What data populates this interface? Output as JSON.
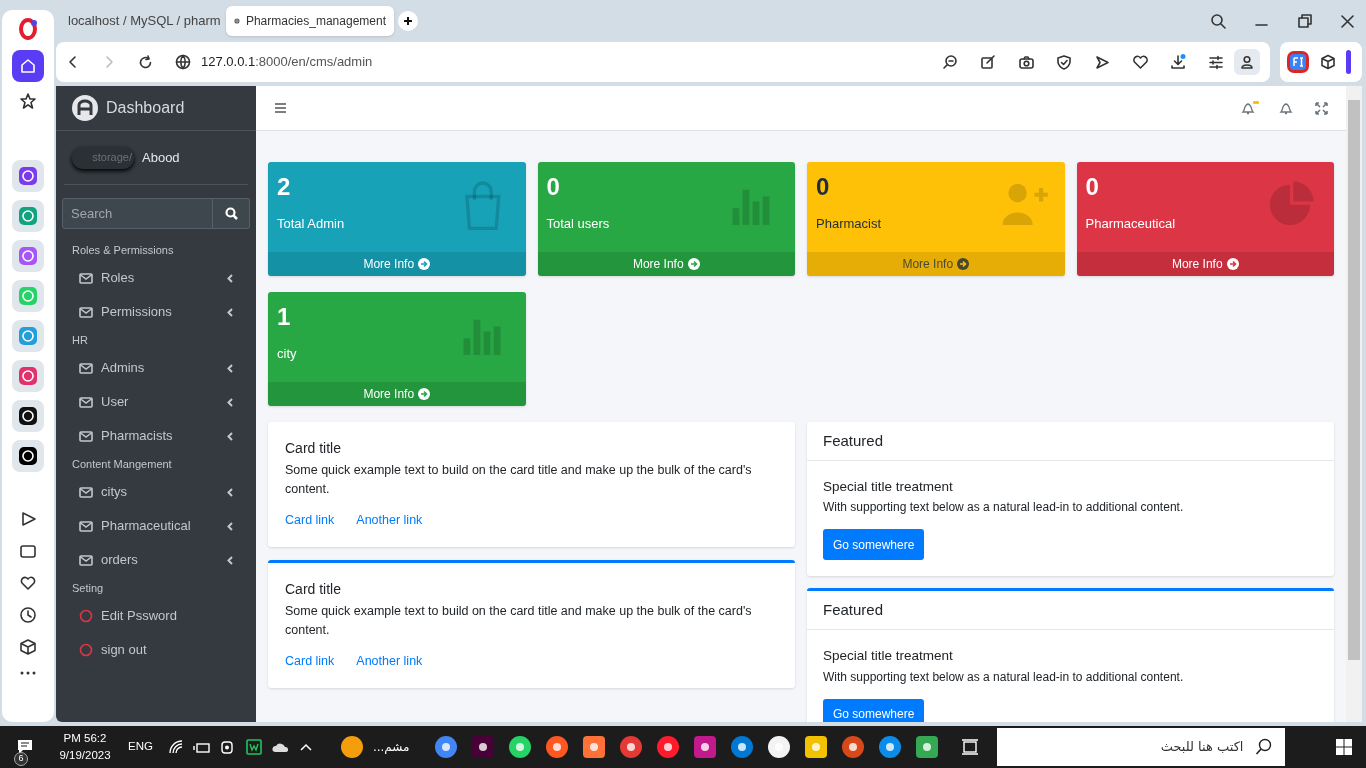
{
  "browser": {
    "tabs": [
      {
        "title": "localhost / MySQL / pharm",
        "selected": false
      },
      {
        "title": "Pharmacies_management",
        "selected": true
      }
    ],
    "url_host": "127.0.0.1",
    "url_rest": ":8000/en/cms/admin"
  },
  "sidebar": {
    "brand": "Dashboard",
    "user_image_alt": "storage/",
    "user": "Abood",
    "search_placeholder": "Search",
    "sections": [
      {
        "title": "Roles & Permissions",
        "items": [
          {
            "label": "Roles",
            "kind": "menu"
          },
          {
            "label": "Permissions",
            "kind": "menu"
          }
        ]
      },
      {
        "title": "HR",
        "items": [
          {
            "label": "Admins",
            "kind": "menu"
          },
          {
            "label": "User",
            "kind": "menu"
          },
          {
            "label": "Pharmacists",
            "kind": "menu"
          }
        ]
      },
      {
        "title": "Content Mangement",
        "items": [
          {
            "label": "citys",
            "kind": "menu"
          },
          {
            "label": "Pharmaceutical",
            "kind": "menu"
          },
          {
            "label": "orders",
            "kind": "menu"
          }
        ]
      },
      {
        "title": "Seting",
        "items": [
          {
            "label": "Edit Pssword",
            "kind": "action"
          },
          {
            "label": "sign out",
            "kind": "action"
          }
        ]
      }
    ]
  },
  "stats": [
    {
      "value": "2",
      "label": "Total Admin",
      "link": "More Info",
      "color": "#17a2b8",
      "dark_text": false,
      "kind": "bag"
    },
    {
      "value": "0",
      "label": "Total users",
      "link": "More Info",
      "color": "#28a745",
      "dark_text": false,
      "kind": "chart"
    },
    {
      "value": "0",
      "label": "Pharmacist",
      "link": "More Info",
      "color": "#ffc107",
      "dark_text": true,
      "kind": "person"
    },
    {
      "value": "0",
      "label": "Pharmaceutical",
      "link": "More Info",
      "color": "#dc3545",
      "dark_text": false,
      "kind": "pie"
    },
    {
      "value": "1",
      "label": "city",
      "link": "More Info",
      "color": "#28a745",
      "dark_text": false,
      "kind": "chart"
    }
  ],
  "cards": [
    {
      "title": "Card title",
      "text": "Some quick example text to build on the card title and make up the bulk of the card's content.",
      "links": [
        "Card link",
        "Another link"
      ],
      "outline": false
    },
    {
      "title": "Card title",
      "text": "Some quick example text to build on the card title and make up the bulk of the card's content.",
      "links": [
        "Card link",
        "Another link"
      ],
      "outline": true
    }
  ],
  "featured": [
    {
      "header": "Featured",
      "title": "Special title treatment",
      "text": "With supporting text below as a natural lead-in to additional content.",
      "button": "Go somewhere",
      "outline": false
    },
    {
      "header": "Featured",
      "title": "Special title treatment",
      "text": "With supporting text below as a natural lead-in to additional content.",
      "button": "Go somewhere",
      "outline": true
    }
  ],
  "taskbar": {
    "notifications": "6",
    "time": "PM 56:2",
    "date": "9/19/2023",
    "language": "ENG",
    "running_app": "مشم...",
    "search_placeholder": "اكتب هنا للبحث"
  }
}
